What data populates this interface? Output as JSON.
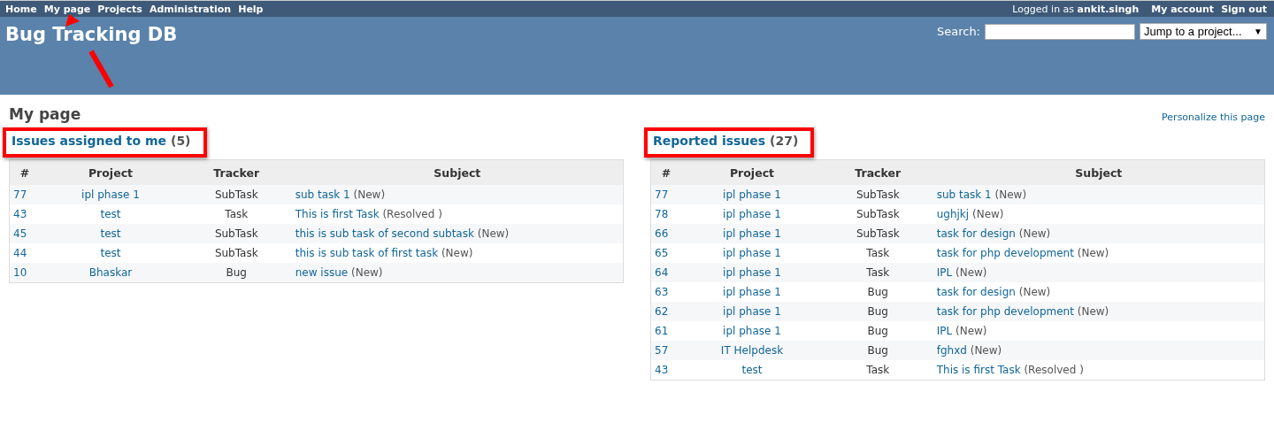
{
  "top_menu": {
    "items": [
      {
        "label": "Home"
      },
      {
        "label": "My page"
      },
      {
        "label": "Projects"
      },
      {
        "label": "Administration"
      },
      {
        "label": "Help"
      }
    ],
    "logged_in_prefix": "Logged in as",
    "user": "ankit.singh",
    "account_links": [
      "My account",
      "Sign out"
    ]
  },
  "header": {
    "title": "Bug Tracking DB",
    "search_label": "Search:",
    "project_jump": "Jump to a project...",
    "dropdown_arrow": "▼"
  },
  "page": {
    "title": "My page",
    "personalize": "Personalize this page"
  },
  "annotations": {
    "arrow": true
  },
  "panels": [
    {
      "title": "Issues assigned to me",
      "count": "(5)",
      "highlighted": true,
      "columns": [
        "#",
        "Project",
        "Tracker",
        "Subject"
      ],
      "rows": [
        {
          "id": "77",
          "project": "ipl phase 1",
          "tracker": "SubTask",
          "subject": "sub task 1",
          "status": "(New)"
        },
        {
          "id": "43",
          "project": "test",
          "tracker": "Task",
          "subject": "This is first Task",
          "status": "(Resolved )"
        },
        {
          "id": "45",
          "project": "test",
          "tracker": "SubTask",
          "subject": "this is sub task of second subtask",
          "status": "(New)"
        },
        {
          "id": "44",
          "project": "test",
          "tracker": "SubTask",
          "subject": "this is sub task of first task",
          "status": "(New)"
        },
        {
          "id": "10",
          "project": "Bhaskar",
          "tracker": "Bug",
          "subject": "new issue",
          "status": "(New)"
        }
      ]
    },
    {
      "title": "Reported issues",
      "count": "(27)",
      "highlighted": true,
      "columns": [
        "#",
        "Project",
        "Tracker",
        "Subject"
      ],
      "rows": [
        {
          "id": "77",
          "project": "ipl phase 1",
          "tracker": "SubTask",
          "subject": "sub task 1",
          "status": "(New)"
        },
        {
          "id": "78",
          "project": "ipl phase 1",
          "tracker": "SubTask",
          "subject": "ughjkj",
          "status": "(New)"
        },
        {
          "id": "66",
          "project": "ipl phase 1",
          "tracker": "SubTask",
          "subject": "task for design",
          "status": "(New)"
        },
        {
          "id": "65",
          "project": "ipl phase 1",
          "tracker": "Task",
          "subject": "task for php development",
          "status": "(New)"
        },
        {
          "id": "64",
          "project": "ipl phase 1",
          "tracker": "Task",
          "subject": "IPL",
          "status": "(New)"
        },
        {
          "id": "63",
          "project": "ipl phase 1",
          "tracker": "Bug",
          "subject": "task for design",
          "status": "(New)"
        },
        {
          "id": "62",
          "project": "ipl phase 1",
          "tracker": "Bug",
          "subject": "task for php development",
          "status": "(New)"
        },
        {
          "id": "61",
          "project": "ipl phase 1",
          "tracker": "Bug",
          "subject": "IPL",
          "status": "(New)"
        },
        {
          "id": "57",
          "project": "IT Helpdesk",
          "tracker": "Bug",
          "subject": "fghxd",
          "status": "(New)"
        },
        {
          "id": "43",
          "project": "test",
          "tracker": "Task",
          "subject": "This is first Task",
          "status": "(Resolved )"
        }
      ]
    }
  ]
}
